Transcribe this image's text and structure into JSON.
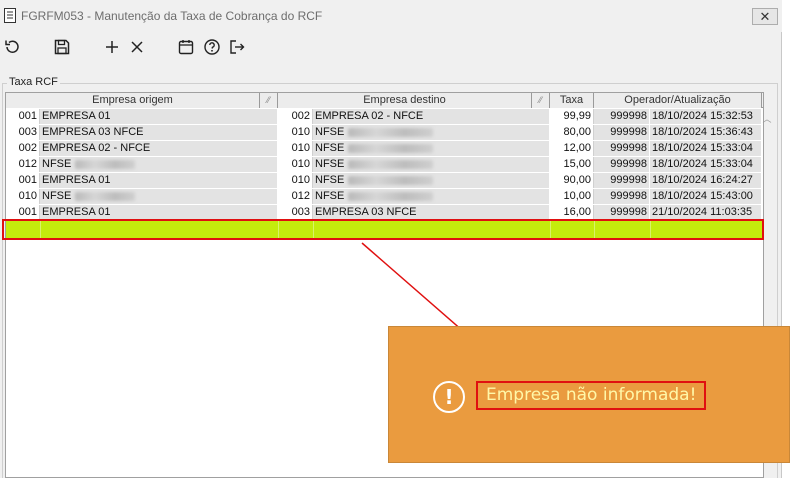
{
  "window": {
    "title": "FGRFM053 - Manutenção da Taxa de Cobrança do RCF",
    "close_label": "✕"
  },
  "toolbar": {
    "icons": [
      "refresh-icon",
      "save-icon",
      "add-icon",
      "delete-icon",
      "calendar-icon",
      "help-icon",
      "exit-icon"
    ]
  },
  "group": {
    "label": "Taxa RCF"
  },
  "grid": {
    "headers": {
      "origem": "Empresa origem",
      "destino": "Empresa destino",
      "taxa": "Taxa",
      "operador": "Operador/Atualização"
    },
    "rows": [
      {
        "orig_code": "001",
        "orig_name": "EMPRESA 01",
        "orig_blur": false,
        "dest_code": "002",
        "dest_name": "EMPRESA 02 - NFCE",
        "dest_blur": false,
        "taxa": "99,99",
        "operador": "999998",
        "data": "18/10/2024 15:32:53"
      },
      {
        "orig_code": "003",
        "orig_name": "EMPRESA 03 NFCE",
        "orig_blur": false,
        "dest_code": "010",
        "dest_name": "NFSE",
        "dest_blur": true,
        "taxa": "80,00",
        "operador": "999998",
        "data": "18/10/2024 15:36:43"
      },
      {
        "orig_code": "002",
        "orig_name": "EMPRESA 02 - NFCE",
        "orig_blur": false,
        "dest_code": "010",
        "dest_name": "NFSE",
        "dest_blur": true,
        "taxa": "12,00",
        "operador": "999998",
        "data": "18/10/2024 15:33:04"
      },
      {
        "orig_code": "012",
        "orig_name": "NFSE",
        "orig_blur": true,
        "dest_code": "010",
        "dest_name": "NFSE",
        "dest_blur": true,
        "taxa": "15,00",
        "operador": "999998",
        "data": "18/10/2024 15:33:04"
      },
      {
        "orig_code": "001",
        "orig_name": "EMPRESA 01",
        "orig_blur": false,
        "dest_code": "010",
        "dest_name": "NFSE",
        "dest_blur": true,
        "taxa": "90,00",
        "operador": "999998",
        "data": "18/10/2024 16:24:27"
      },
      {
        "orig_code": "010",
        "orig_name": "NFSE",
        "orig_blur": true,
        "dest_code": "012",
        "dest_name": "NFSE",
        "dest_blur": true,
        "taxa": "10,00",
        "operador": "999998",
        "data": "18/10/2024 15:43:00"
      },
      {
        "orig_code": "001",
        "orig_name": "EMPRESA 01",
        "orig_blur": false,
        "dest_code": "003",
        "dest_name": "EMPRESA 03 NFCE",
        "dest_blur": false,
        "taxa": "16,00",
        "operador": "999998",
        "data": "21/10/2024 11:03:35"
      }
    ]
  },
  "toast": {
    "message": "Empresa não informada!",
    "icon": "exclamation-icon",
    "icon_glyph": "!"
  },
  "colors": {
    "new_row": "#c4ec0c",
    "toast_bg": "#ea9b3f",
    "highlight": "#e01010"
  }
}
